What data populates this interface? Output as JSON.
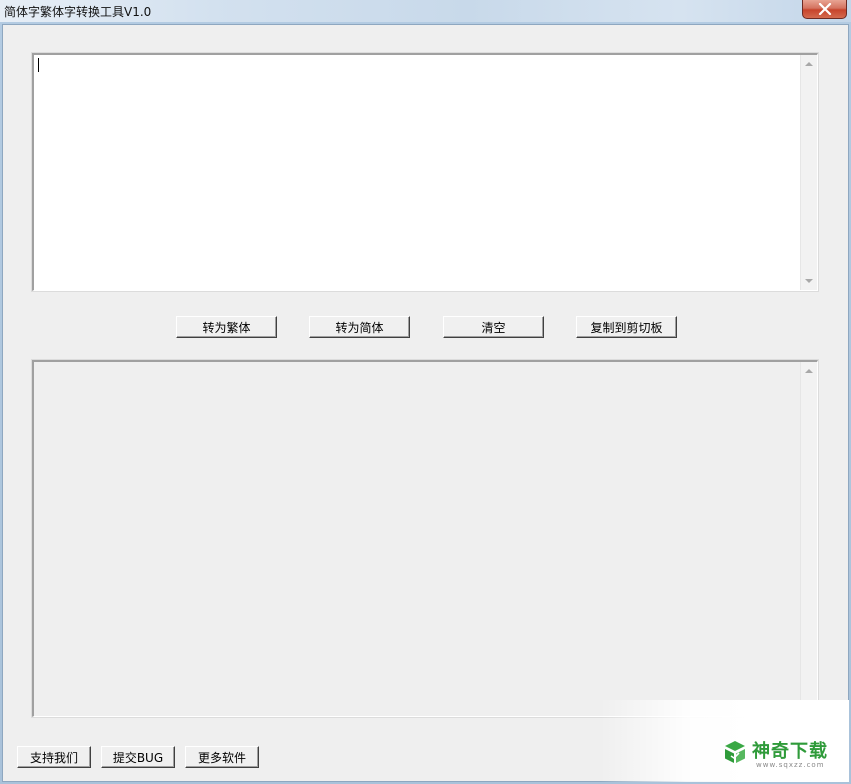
{
  "window": {
    "title": "简体字繁体字转换工具V1.0"
  },
  "input_area": {
    "value": ""
  },
  "output_area": {
    "value": ""
  },
  "actions": {
    "to_traditional": "转为繁体",
    "to_simplified": "转为简体",
    "clear": "清空",
    "copy_to_clipboard": "复制到剪切板"
  },
  "footer": {
    "support_us": "支持我们",
    "submit_bug": "提交BUG",
    "more_software": "更多软件"
  },
  "watermark": {
    "brand": "神奇下载",
    "url": "www.sqxzz.com"
  },
  "colors": {
    "close_button": "#c7442c",
    "watermark_green": "#2f9b3a",
    "client_background": "#efefef"
  }
}
